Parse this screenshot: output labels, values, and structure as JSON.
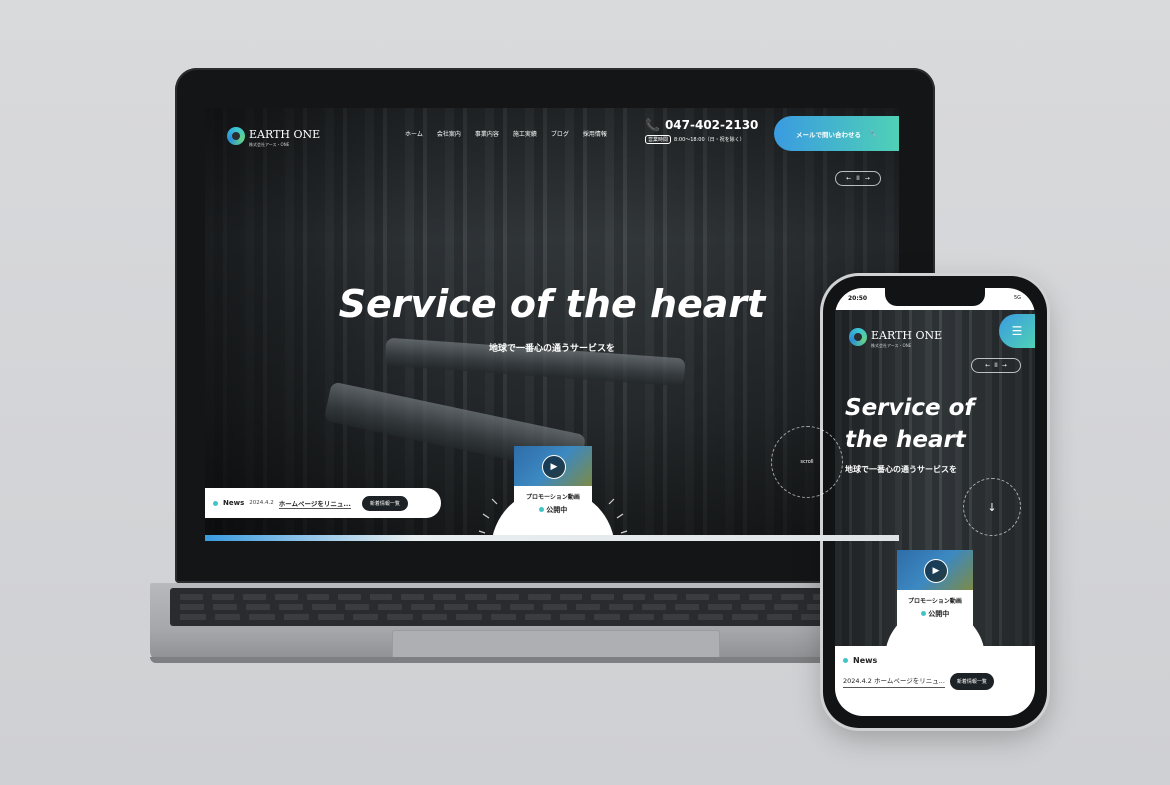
{
  "brand": {
    "name": "EARTH ONE",
    "sub": "株式会社アース・ONE"
  },
  "nav": [
    "ホーム",
    "会社案内",
    "事業内容",
    "施工実績",
    "ブログ",
    "採用情報"
  ],
  "contact": {
    "phone": "047-402-2130",
    "hours_badge": "営業時間",
    "hours": "8:00～18:00（日・祝を除く）",
    "mail_button": "メールで問い合わせる"
  },
  "slider_controls": {
    "prev": "←",
    "pause": "II",
    "next": "→"
  },
  "hero": {
    "title": "Service of the heart",
    "title_line1": "Service of",
    "title_line2": "the heart",
    "subtitle": "地球で一番心の通うサービスを"
  },
  "news": {
    "label": "News",
    "date": "2024.4.2",
    "headline": "ホームページをリニュ...",
    "button": "新着情報一覧"
  },
  "promo": {
    "label": "プロモーション動画",
    "status": "公開中"
  },
  "scroll_label": "scroll",
  "phone_status": {
    "time": "20:50",
    "signal": "5G"
  },
  "colors": {
    "accent_start": "#3a9be0",
    "accent_end": "#4fd1b6",
    "dark_button": "#1c2226",
    "dot": "#41c4c6"
  },
  "icons": [
    "phone-icon",
    "wrench-icon",
    "play-icon",
    "menu-icon",
    "arrow-down-icon"
  ]
}
